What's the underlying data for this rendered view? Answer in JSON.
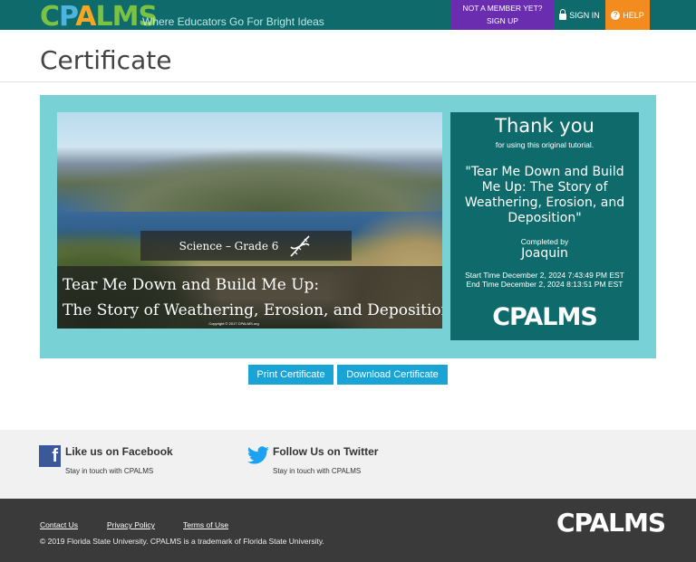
{
  "header": {
    "logo": "CPALMS",
    "tagline": "Where Educators Go For Bright Ideas",
    "member_line1": "NOT A MEMBER YET?",
    "member_line2": "SIGN UP",
    "signin": "SIGN IN",
    "help": "HELP",
    "colors": {
      "bar": "#0f6b6b",
      "member": "#6a2db0",
      "help": "#f28c1e"
    }
  },
  "page": {
    "title": "Certificate"
  },
  "certificate": {
    "image": {
      "subject": "Science – Grade 6",
      "title_line1": "Tear Me Down and Build Me Up:",
      "title_line2": "The Story of Weathering, Erosion, and Deposition",
      "copyright": "Copyright © 2017 CPALMS.org"
    },
    "thank_you": "Thank you",
    "thank_sub": "for using this original tutorial.",
    "tutorial_title": "\"Tear Me Down and Build Me Up: The Story of Weathering, Erosion, and Deposition\"",
    "completed_by_label": "Completed by",
    "student": "Joaquin",
    "start_time": "Start Time December 2, 2024 7:43:49 PM EST",
    "end_time": "End Time December 2, 2024 8:13:51 PM EST",
    "panel_logo": "CPALMS",
    "colors": {
      "frame": "#78d1d4",
      "panel": "#0f6b6b"
    }
  },
  "actions": {
    "print": "Print Certificate",
    "download": "Download Certificate"
  },
  "social": {
    "facebook_title": "Like us on Facebook",
    "facebook_sub": "Stay in touch with CPALMS",
    "twitter_title": "Follow Us on Twitter",
    "twitter_sub": "Stay in touch with CPALMS"
  },
  "footer": {
    "links": [
      "Contact Us",
      "Privacy Policy",
      "Terms of Use"
    ],
    "copyright": "© 2019 Florida State University. CPALMS is a trademark of Florida State University.",
    "logo": "CPALMS"
  }
}
